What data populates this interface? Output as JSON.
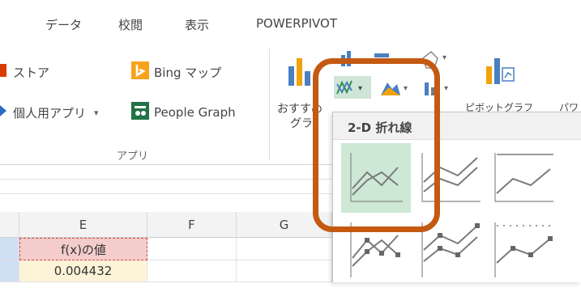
{
  "ribbon": {
    "tabs": [
      {
        "label": "データ"
      },
      {
        "label": "校閲"
      },
      {
        "label": "表示"
      },
      {
        "label": "POWERPIVOT"
      }
    ],
    "apps_group": {
      "store_label": "ストア",
      "bing_maps_label": "Bing マップ",
      "personal_apps_label": "個人用アプリ",
      "people_graph_label": "People Graph",
      "group_label": "アプリ"
    },
    "charts_group": {
      "recommended_label_line1": "おすすめ",
      "recommended_label_line2": "グラ",
      "pivot_chart_label": "ピボットグラフ",
      "power_label": "パワ"
    }
  },
  "dropdown": {
    "section_title": "2-D 折れ線"
  },
  "grid": {
    "columns": [
      "E",
      "F",
      "G"
    ],
    "cells": {
      "e_header_value": "f(x)の値",
      "e_first_value": "0.004432"
    }
  },
  "colors": {
    "highlight": "#c45a12",
    "selected_thumb": "#cde8d5",
    "excel_green": "#217346"
  }
}
